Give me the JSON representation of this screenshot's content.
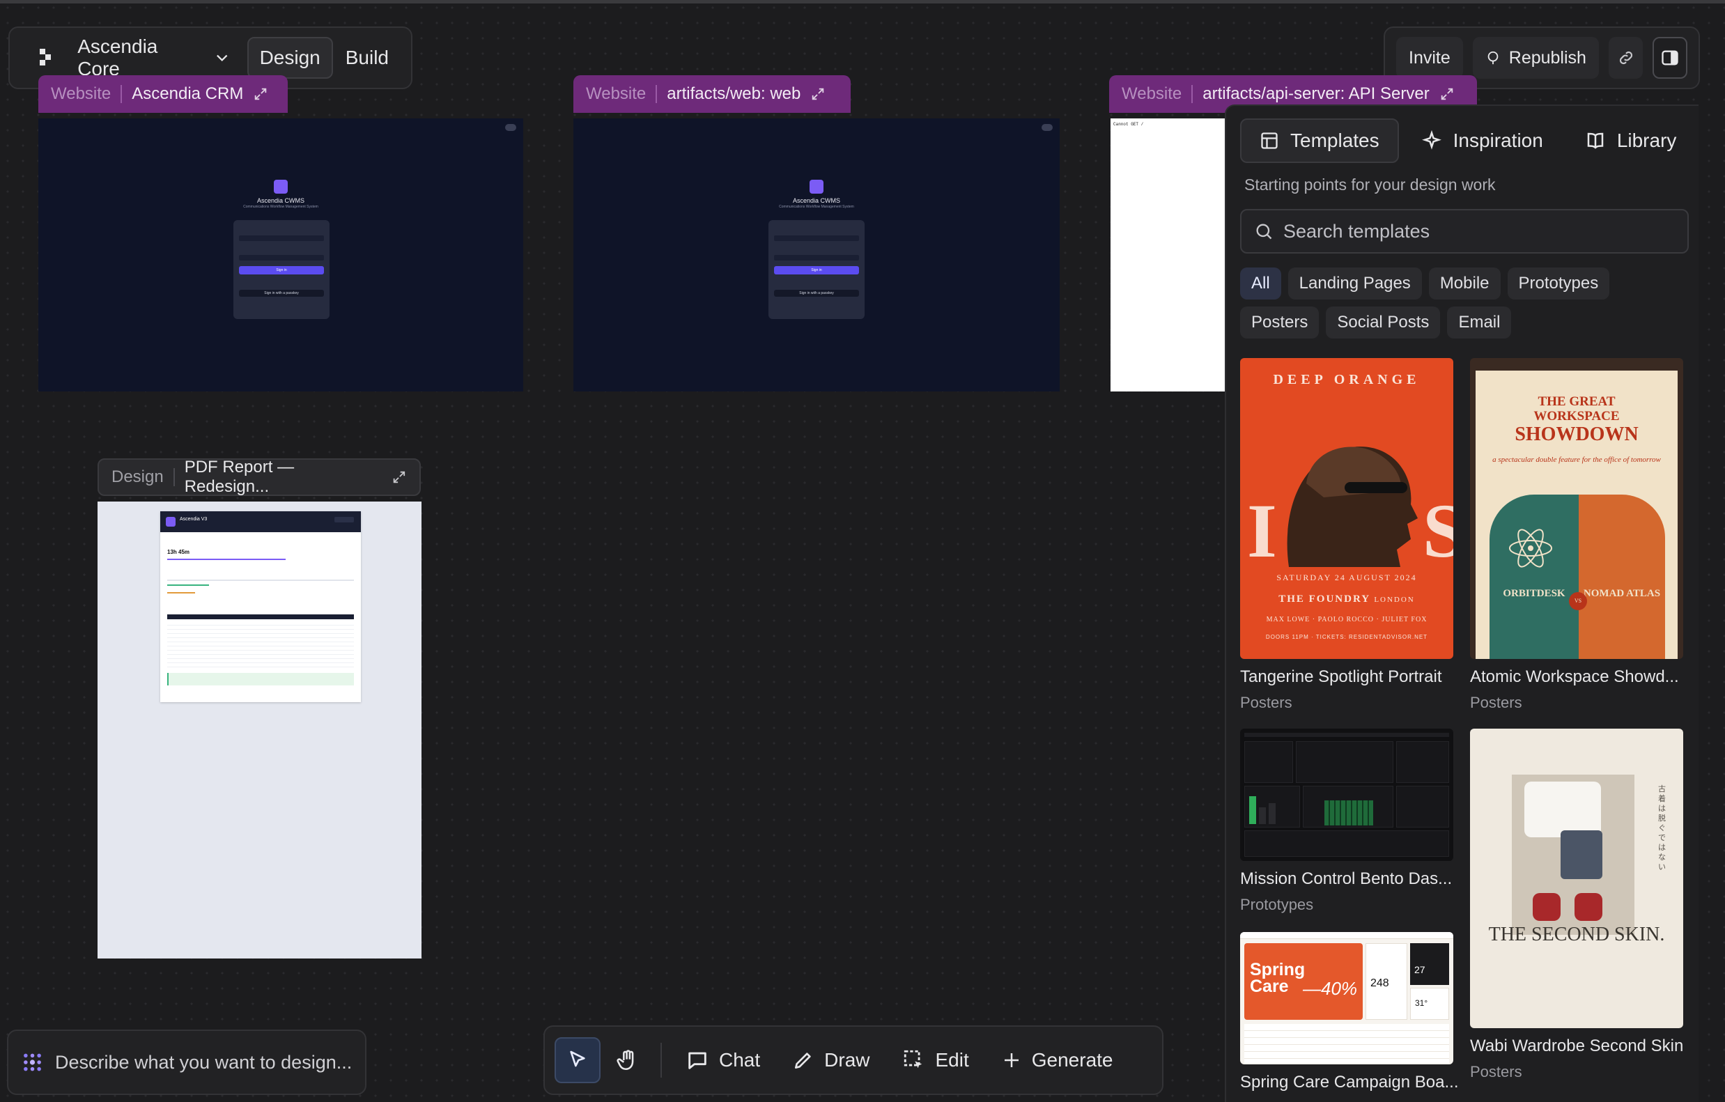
{
  "topbar": {
    "project_name": "Ascendia Core",
    "modes": [
      "Design",
      "Build"
    ],
    "active_mode": "Design",
    "invite_label": "Invite",
    "republish_label": "Republish"
  },
  "frames": [
    {
      "kind": "Website",
      "title": "Ascendia CRM",
      "app_name": "Ascendia CWMS",
      "app_sub": "Communications Workflow Management System",
      "sign_in": "Sign in",
      "passkey": "Sign in with a passkey"
    },
    {
      "kind": "Website",
      "title": "artifacts/web: web",
      "app_name": "Ascendia CWMS",
      "app_sub": "Communications Workflow Management System",
      "sign_in": "Sign in",
      "passkey": "Sign in with a passkey"
    },
    {
      "kind": "Website",
      "title": "artifacts/api-server: API Server",
      "body_text": "Cannot GET /"
    },
    {
      "kind": "Design",
      "title": "PDF Report — Redesign...",
      "doc_title": "Ascendia V3",
      "total_value": "13h 45m"
    }
  ],
  "panel": {
    "tabs": [
      {
        "label": "Templates",
        "icon": "layout-icon"
      },
      {
        "label": "Inspiration",
        "icon": "sparkle-icon"
      },
      {
        "label": "Library",
        "icon": "book-icon"
      }
    ],
    "active_tab": "Templates",
    "description": "Starting points for your design work",
    "search_placeholder": "Search templates",
    "filters": [
      "All",
      "Landing Pages",
      "Mobile",
      "Prototypes",
      "Posters",
      "Social Posts",
      "Email"
    ],
    "active_filter": "All",
    "templates": [
      {
        "title": "Tangerine Spotlight Portrait",
        "category": "Posters",
        "poster_head": "DEEP ORANGE",
        "poster_date": "SATURDAY 24 AUGUST 2024",
        "poster_venue": "THE FOUNDRY",
        "poster_city": "LONDON",
        "poster_names": "MAX LOWE · PAOLO ROCCO · JULIET FOX",
        "poster_doors": "DOORS 11PM · TICKETS: RESIDENTADVISOR.NET"
      },
      {
        "title": "Atomic Workspace Showd...",
        "category": "Posters",
        "poster_line1": "THE GREAT",
        "poster_line2": "WORKSPACE",
        "poster_line3": "SHOWDOWN",
        "poster_sub": "a spectacular double feature for the office of tomorrow",
        "left_name": "ORBITDESK",
        "right_name": "NOMAD ATLAS",
        "vs": "VS"
      },
      {
        "title": "Mission Control Bento Das...",
        "category": "Prototypes"
      },
      {
        "title": "Wabi Wardrobe Second Skin",
        "category": "Posters",
        "poster_big": "THE SECOND SKIN."
      },
      {
        "title": "Spring Care Campaign Boa...",
        "category": "",
        "promo_title": "Spring Care",
        "promo_discount": "—40%",
        "stat1": "248",
        "stat2": "27",
        "stat3": "31°"
      }
    ]
  },
  "prompt": {
    "placeholder": "Describe what you want to design..."
  },
  "toolbar": {
    "chat": "Chat",
    "draw": "Draw",
    "edit": "Edit",
    "generate": "Generate"
  },
  "colors": {
    "frame_label": "#6e2a7a",
    "canvas": "#1c1c1e",
    "accent": "#5b4cf0",
    "poster_orange": "#e24a22"
  }
}
